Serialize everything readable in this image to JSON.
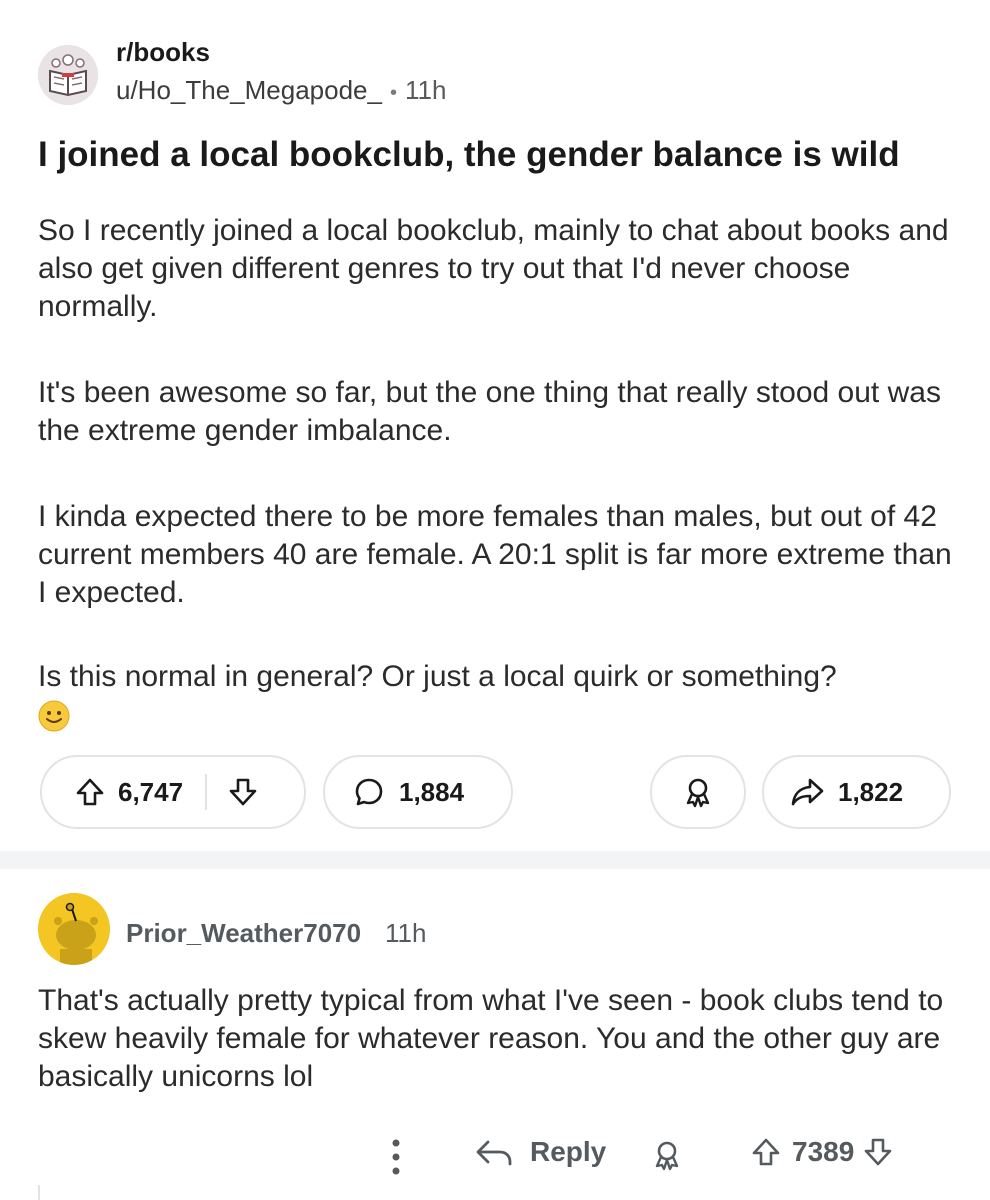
{
  "post": {
    "subreddit": "r/books",
    "author": "u/Ho_The_Megapode_",
    "separator": "•",
    "time": "11h",
    "title": "I joined a local bookclub, the gender balance is wild",
    "body": [
      "So I recently joined a local bookclub, mainly to chat about books and also get given different genres to try out that I'd never choose normally.",
      "It's been awesome so far, but the one thing that really stood out was the extreme gender imbalance.",
      "I kinda expected there to be more females than males, but out of 42 current members 40 are female. A 20:1 split is far more extreme than I expected.",
      "Is this normal in general? Or just a local quirk or something?"
    ],
    "actions": {
      "score": "6,747",
      "comments": "1,884",
      "shares": "1,822"
    }
  },
  "comment": {
    "author": "Prior_Weather7070",
    "time": "11h",
    "body": "That's actually pretty typical from what I've seen - book clubs tend to skew heavily female for whatever reason. You and the other guy are basically unicorns lol",
    "reply_label": "Reply",
    "score": "7389"
  },
  "colors": {
    "accent_avatar": "#f3c623",
    "pill_border": "#e3e3e3",
    "separator": "#f3f4f6",
    "muted_text": "#555a5e"
  },
  "icons": [
    "upvote-icon",
    "downvote-icon",
    "comment-icon",
    "award-icon",
    "share-icon",
    "more-icon",
    "reply-icon",
    "smile-emoji-icon"
  ]
}
